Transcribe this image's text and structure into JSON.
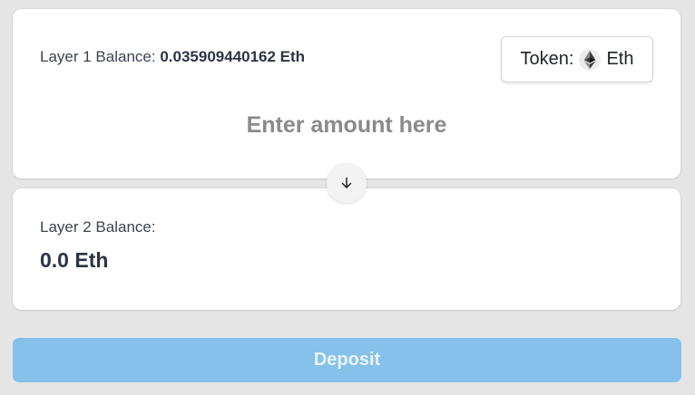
{
  "layer1": {
    "label": "Layer 1 Balance:",
    "value": "0.035909440162 Eth"
  },
  "token": {
    "label": "Token:",
    "symbol": "Eth",
    "icon": "ethereum-icon"
  },
  "amount": {
    "placeholder": "Enter amount here",
    "value": ""
  },
  "swap": {
    "icon": "arrow-down-icon"
  },
  "layer2": {
    "label": "Layer 2 Balance:",
    "value": "0.0 Eth"
  },
  "deposit": {
    "label": "Deposit",
    "color": "#85c1ea"
  }
}
